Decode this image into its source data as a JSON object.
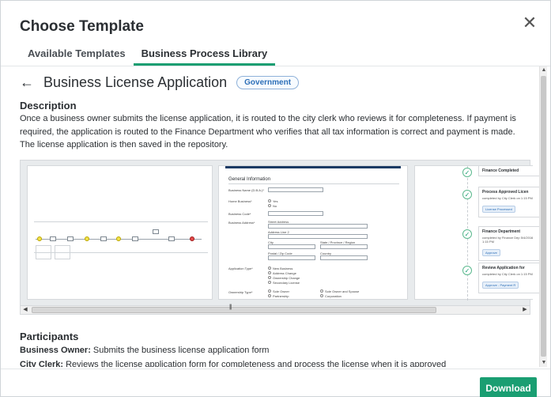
{
  "dialog": {
    "title": "Choose Template",
    "close_icon": "close-icon",
    "close_glyph": "✕"
  },
  "tabs": [
    {
      "label": "Available Templates",
      "active": false
    },
    {
      "label": "Business Process Library",
      "active": true
    }
  ],
  "template": {
    "back_glyph": "←",
    "title": "Business License Application",
    "badge": "Government"
  },
  "description": {
    "heading": "Description",
    "text": "Once a business owner submits the license application, it is routed to the city clerk who reviews it for completeness. If payment is required, the application is routed to the Finance Department who verifies that all tax information is correct and payment is made. The license application is then saved in the repository."
  },
  "previews": {
    "form": {
      "section_title": "General Information",
      "fields": [
        {
          "label": "Business Name (D.B.A.)*"
        },
        {
          "label": "Home Business*",
          "options": [
            "Yes",
            "No"
          ]
        },
        {
          "label": "Business Code*"
        },
        {
          "label": "Business Address*",
          "subfields": [
            "Street Address",
            "Address Line 2",
            "City",
            "State / Province / Region",
            "Postal / Zip Code",
            "Country"
          ]
        },
        {
          "label": "Application Type*",
          "options": [
            "New Business",
            "Address Change",
            "Ownership Change",
            "Secondary License"
          ]
        },
        {
          "label": "Ownership Type*",
          "options": [
            "Sole Owner",
            "Partnership",
            "Sole Owner and Spouse",
            "Corporation"
          ]
        }
      ]
    },
    "history": [
      {
        "title": "Finance Completed",
        "meta": "",
        "tag": ""
      },
      {
        "title": "Process Approved Licen",
        "meta": "completed by City Clerk on 1:15 PM",
        "tag": "License Processed"
      },
      {
        "title": "Finance Department",
        "meta": "completed by Finance Dep 5/4/2016 1:15 PM",
        "tag": "Approve"
      },
      {
        "title": "Review Application for",
        "meta": "completed by City Clerk on 1:15 PM",
        "tag": "Approve - Payment R"
      }
    ]
  },
  "scrollbar": {
    "left_arrow": "◀",
    "right_arrow": "▶",
    "grip": "|||",
    "up_arrow": "▲",
    "down_arrow": "▼"
  },
  "participants": {
    "heading": "Participants",
    "items": [
      {
        "role": "Business Owner:",
        "text": " Submits the business license application form"
      },
      {
        "role": "City Clerk:",
        "text": " Reviews the license application form for completeness and process the license when it is approved"
      }
    ]
  },
  "footer": {
    "download_label": "Download"
  },
  "colors": {
    "accent": "#1a9e72",
    "badge": "#2d6fb8"
  }
}
